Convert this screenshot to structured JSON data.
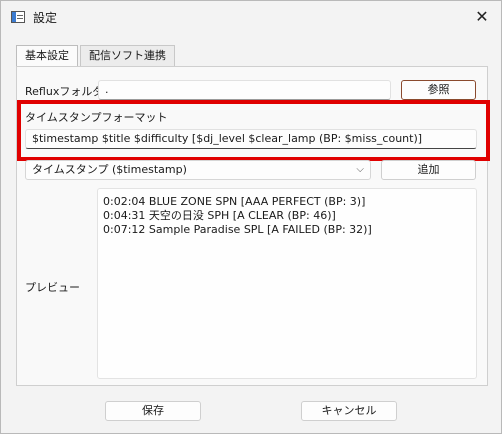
{
  "window": {
    "title": "設定"
  },
  "tabs": [
    {
      "label": "基本設定"
    },
    {
      "label": "配信ソフト連携"
    }
  ],
  "reflux": {
    "label": "Refluxフォルダ",
    "value": ".",
    "browse_label": "参照"
  },
  "timestamp_format": {
    "label": "タイムスタンプフォーマット",
    "value": "$timestamp $title $difficulty [$dj_level $clear_lamp (BP: $miss_count)]"
  },
  "variable": {
    "selected": "タイムスタンプ ($timestamp)",
    "add_label": "追加"
  },
  "preview": {
    "label": "プレビュー",
    "lines": [
      "0:02:04 BLUE ZONE SPN [AAA PERFECT (BP: 3)]",
      "0:04:31 天空の日没 SPH [A CLEAR (BP: 46)]",
      "0:07:12 Sample Paradise SPL [A FAILED (BP: 32)]"
    ]
  },
  "footer": {
    "save_label": "保存",
    "cancel_label": "キャンセル"
  },
  "colors": {
    "highlight": "#e00000",
    "accent_border": "#8a4a2e"
  },
  "icons": {
    "app": "settings-window-icon",
    "close": "close-icon",
    "dropdown": "chevron-down-icon"
  }
}
